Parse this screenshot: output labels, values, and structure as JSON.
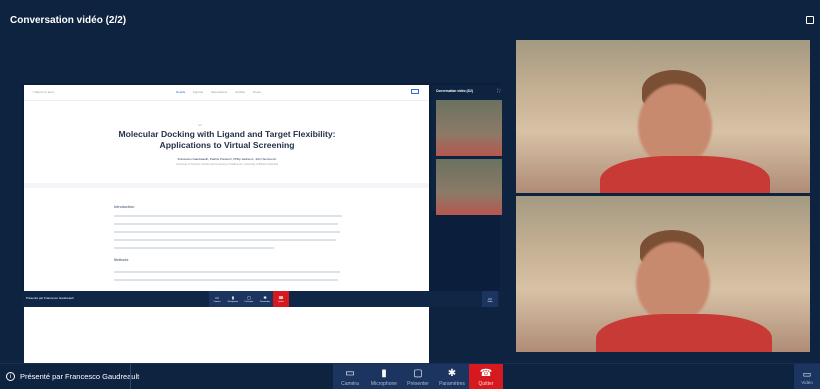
{
  "window": {
    "title": "Conversation vidéo (2/2)"
  },
  "shared_screen": {
    "doc": {
      "back_link": "< Return to feed",
      "tabs": [
        "Details",
        "Figures",
        "Discussions",
        "Articles",
        "Notes"
      ],
      "kicker": "ref",
      "title": "Molecular Docking with Ligand and Target Flexibility: Applications to Virtual Screening",
      "authors": "Francesco Gaudreault¹, Patrick Poisson², Philip Jackson¹, John Summers¹",
      "affiliation": "University of Toronto, Ontario and University of Melbourne, University of British Columbia",
      "section1": "Introduction",
      "section2": "Methods"
    },
    "selfview": {
      "title": "Conversation vidéo (2/2)"
    },
    "bar": {
      "presented_by": "Présenté par Francesco Gaudreault",
      "buttons": [
        "Caméra",
        "Microphone",
        "Présenter",
        "Paramètres",
        "Quitter"
      ],
      "video": "Vidéo"
    }
  },
  "footer": {
    "presented_by": "Présenté par Francesco Gaudreault",
    "controls": {
      "camera": "Caméra",
      "microphone": "Microphone",
      "present": "Présenter",
      "settings": "Paramètres",
      "quit": "Quitter"
    },
    "video": "Vidéo"
  },
  "colors": {
    "background": "#0e2340",
    "quit": "#d6191e",
    "button": "#1b3560"
  },
  "icons": [
    "expand-icon",
    "info-icon",
    "camera-icon",
    "microphone-icon",
    "present-icon",
    "gear-icon",
    "hangup-icon",
    "video-icon"
  ]
}
